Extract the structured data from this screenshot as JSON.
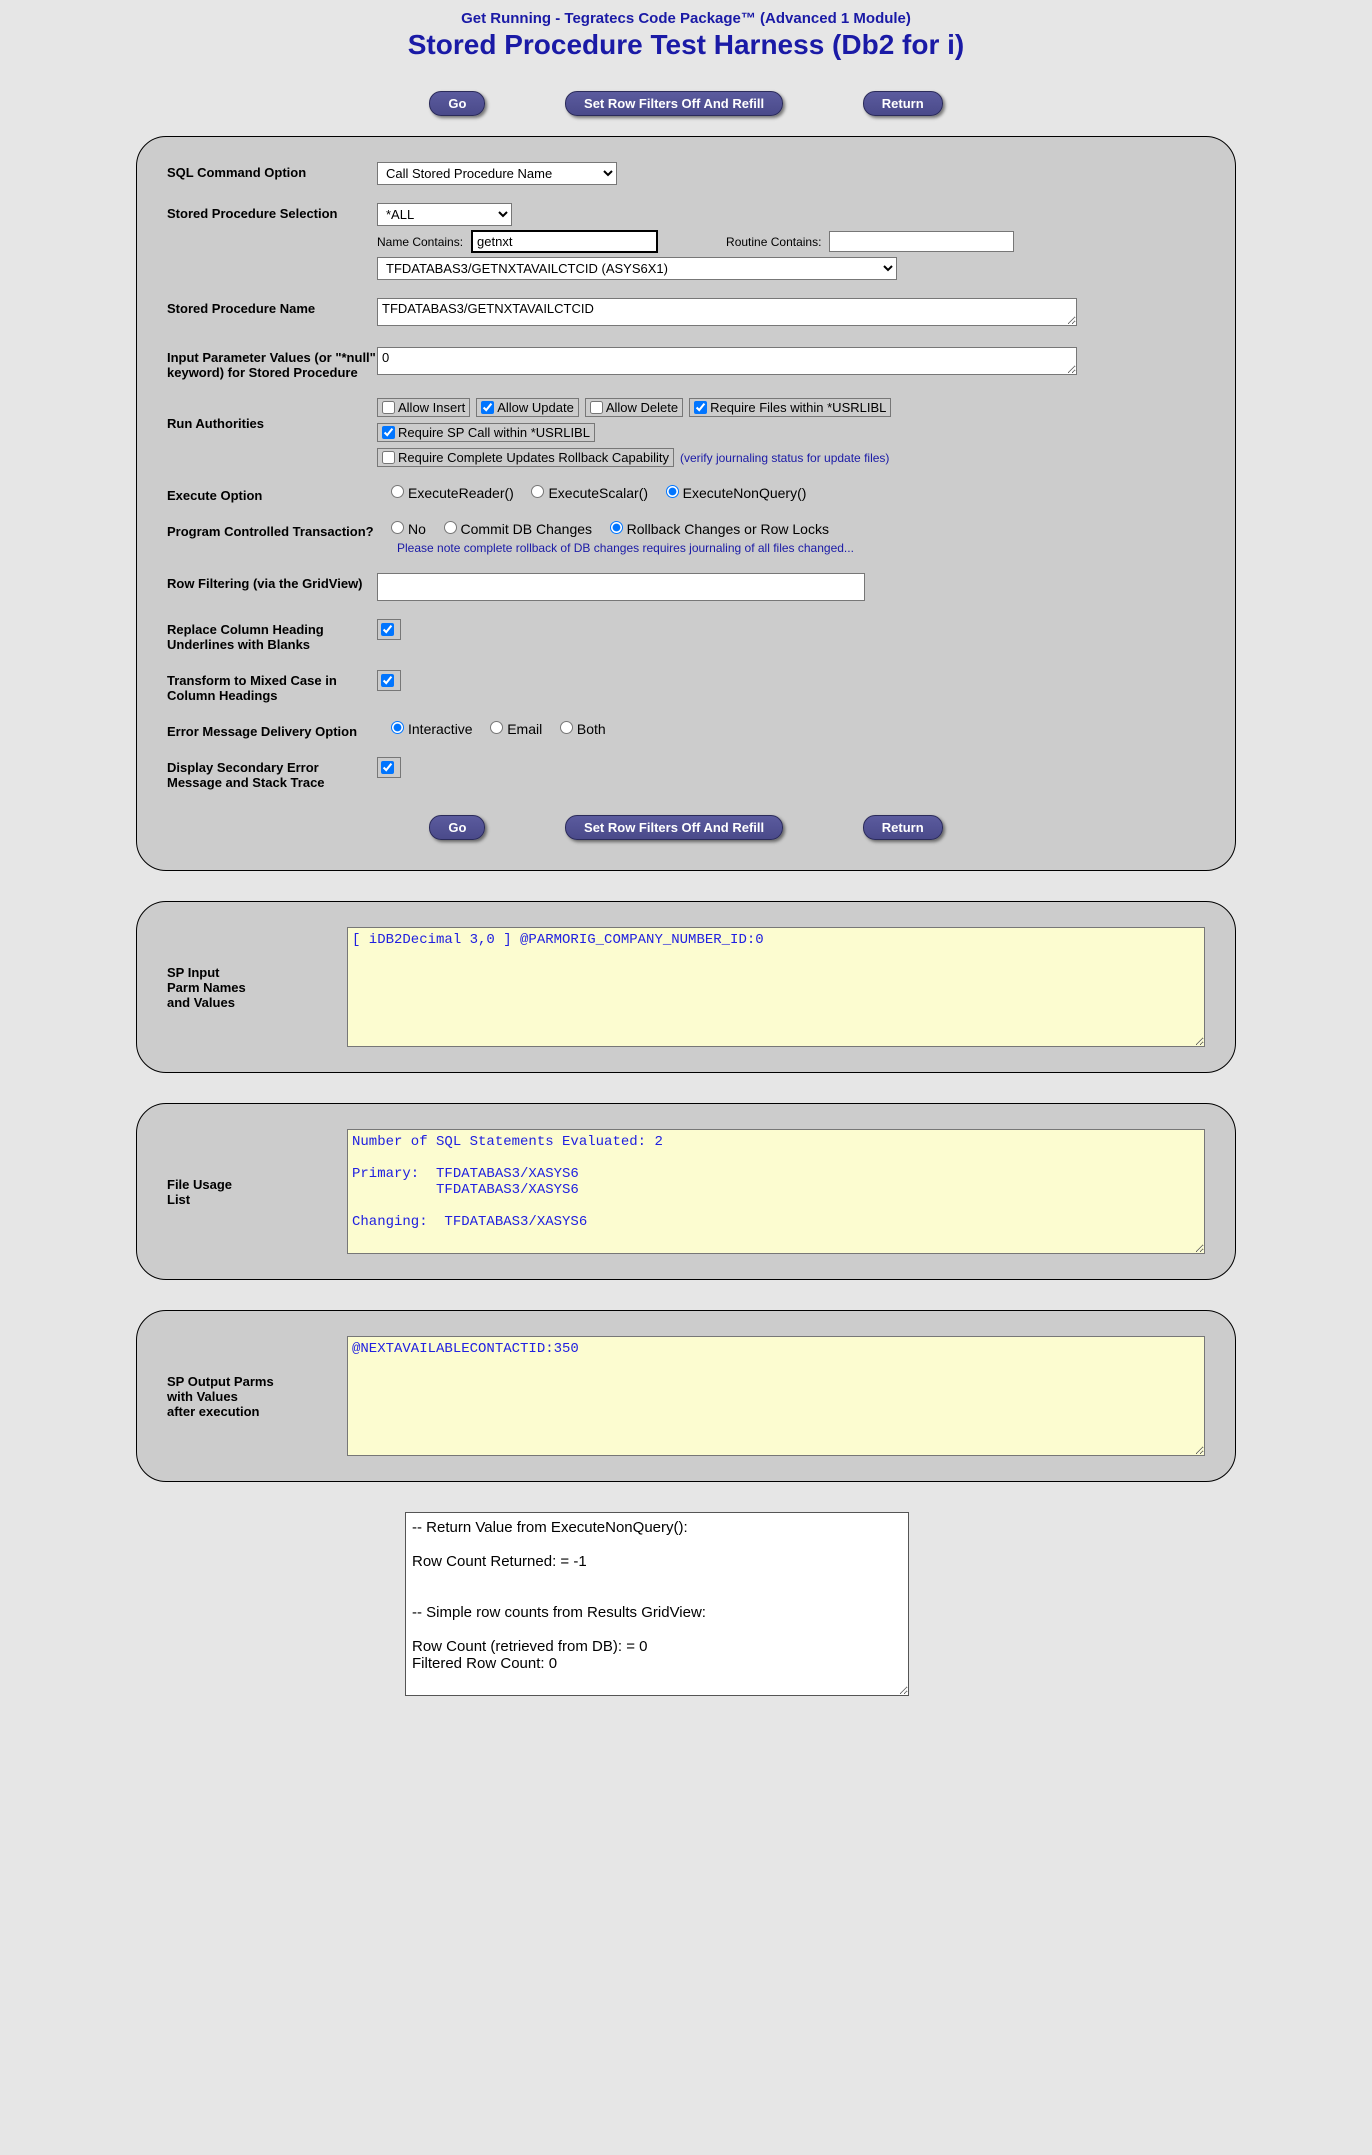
{
  "header": {
    "subtitle": "Get Running - Tegratecs Code Package™ (Advanced 1 Module)",
    "title": "Stored Procedure Test Harness (Db2 for i)"
  },
  "buttons": {
    "go": "Go",
    "setrow": "Set Row Filters Off And Refill",
    "return": "Return"
  },
  "labels": {
    "sql_command_option": "SQL Command Option",
    "stored_procedure_selection": "Stored Procedure Selection",
    "name_contains": "Name Contains:",
    "routine_contains": "Routine Contains:",
    "stored_procedure_name": "Stored Procedure Name",
    "input_param_values": "Input Parameter Values (or \"*null\" keyword) for Stored Procedure",
    "run_authorities": "Run Authorities",
    "allow_insert": "Allow Insert",
    "allow_update": "Allow Update",
    "allow_delete": "Allow Delete",
    "require_files": "Require Files within *USRLIBL",
    "require_sp": "Require SP Call within *USRLIBL",
    "require_rollback": "Require Complete Updates Rollback Capability",
    "journal_note": "(verify journaling status for update files)",
    "execute_option": "Execute Option",
    "exec_reader": "ExecuteReader()",
    "exec_scalar": "ExecuteScalar()",
    "exec_nonquery": "ExecuteNonQuery()",
    "transaction": "Program Controlled Transaction?",
    "trans_no": "No",
    "trans_commit": "Commit DB Changes",
    "trans_rollback": "Rollback Changes or Row Locks",
    "trans_note": "Please note complete rollback of DB changes requires journaling of all files changed...",
    "row_filtering": "Row Filtering (via the GridView)",
    "replace_underline": "Replace Column Heading Underlines with Blanks",
    "mixed_case": "Transform to Mixed Case in Column Headings",
    "error_delivery": "Error Message Delivery Option",
    "err_interactive": "Interactive",
    "err_email": "Email",
    "err_both": "Both",
    "display_secondary": "Display Secondary Error Message and Stack Trace",
    "sp_input_parm": "SP Input\nParm Names\nand Values",
    "file_usage": "File Usage\nList",
    "sp_output_parm": "SP Output Parms\nwith Values\nafter execution"
  },
  "values": {
    "sql_command_option": "Call Stored Procedure Name",
    "sp_sel_dropdown1": "*ALL",
    "name_contains": "getnxt",
    "routine_contains": "",
    "sp_sel_dropdown2": "TFDATABAS3/GETNXTAVAILCTCID (ASYS6X1)",
    "stored_procedure_name": "TFDATABAS3/GETNXTAVAILCTCID",
    "input_param_values": "0",
    "row_filtering": "",
    "sp_input_parm_text": "[ iDB2Decimal 3,0 ] @PARMORIG_COMPANY_NUMBER_ID:0",
    "file_usage_text": "Number of SQL Statements Evaluated: 2\n\nPrimary:  TFDATABAS3/XASYS6\n          TFDATABAS3/XASYS6\n\nChanging:  TFDATABAS3/XASYS6",
    "sp_output_parm_text": "@NEXTAVAILABLECONTACTID:350",
    "final_text": "-- Return Value from ExecuteNonQuery():\n\nRow Count Returned: = -1\n\n\n-- Simple row counts from Results GridView:\n\nRow Count (retrieved from DB): = 0\nFiltered Row Count: 0"
  },
  "checks": {
    "allow_insert": false,
    "allow_update": true,
    "allow_delete": false,
    "require_files": true,
    "require_sp": true,
    "require_rollback": false,
    "replace_underline": true,
    "mixed_case": true,
    "display_secondary": true
  }
}
